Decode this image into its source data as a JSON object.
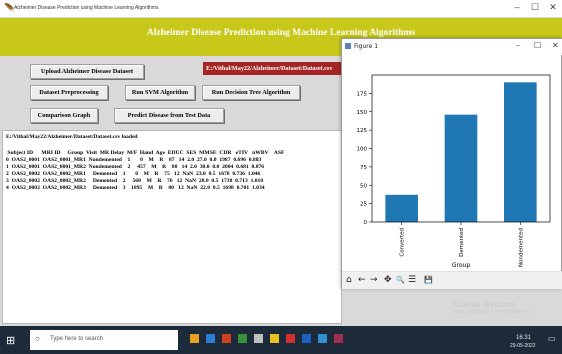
{
  "window": {
    "title": "Alzheimer Disease Prediction using Machine Learning Algorithms",
    "controls": [
      "–",
      "☐",
      "✕"
    ]
  },
  "banner": {
    "text": "Alzheimer Disease Prediction using Machine Learning Algorithms"
  },
  "buttons": {
    "upload": "Upload Alzheimer Disease Dataset",
    "preprocess": "Dataset Preprocessing",
    "svm": "Run SVM Algorithm",
    "dtree": "Run Decision Tree Algorithm",
    "comparison": "Comparison Graph",
    "predict": "Predict Disease from Test Data"
  },
  "path_field": {
    "value": "E:/Vithal/May22/Alzheimer/Dataset/Dataset.csv"
  },
  "output": {
    "lines": [
      "E:/Vithal/May22/Alzheimer/Dataset/Dataset.csv loaded",
      "",
      " Subject ID      MRI ID     Group  Visit  MR Delay  M/F  Hand  Age  EDUC  SES  MMSE  CDR   eTIV   nWBV    ASF",
      "0  OAS2_0001  OAS2_0001_MR1  Nondemented    1       0    M    R    87   14  2.0  27.0  0.0  1987  0.696  0.883",
      "1  OAS2_0001  OAS2_0001_MR2  Nondemented    2     457    M    R    88   14  2.0  30.0  0.0  2004  0.681  0.876",
      "2  OAS2_0002  OAS2_0002_MR1     Demented    1       0    M    R    75   12  NaN  23.0  0.5  1678  0.736  1.046",
      "3  OAS2_0002  OAS2_0002_MR2     Demented    2     560    M    R    76   12  NaN  28.0  0.5  1738  0.713  1.010",
      "4  OAS2_0002  OAS2_0002_MR3     Demented    3    1895    M    R    80   12  NaN  22.0  0.5  1698  0.701  1.034"
    ]
  },
  "figure": {
    "title": "Figure 1",
    "controls": [
      "–",
      "☐",
      "✕"
    ],
    "toolbar": [
      "⌂",
      "←",
      "→",
      "✥",
      "🔍",
      "☰",
      "💾"
    ]
  },
  "chart_data": {
    "type": "bar",
    "categories": [
      "Converted",
      "Demented",
      "Nondemented"
    ],
    "values": [
      37,
      146,
      190
    ],
    "xlabel": "Group",
    "ylabel": "",
    "ylim": [
      0,
      200
    ],
    "yticks": [
      0,
      25,
      50,
      75,
      100,
      125,
      150,
      175
    ],
    "color": "#1f77b4"
  },
  "watermark": {
    "line1": "Activate Windows",
    "line2": "Go to Settings to activate Windows."
  },
  "taskbar": {
    "search_placeholder": "Type here to search",
    "time": "16:31",
    "date": "29-05-2022"
  }
}
